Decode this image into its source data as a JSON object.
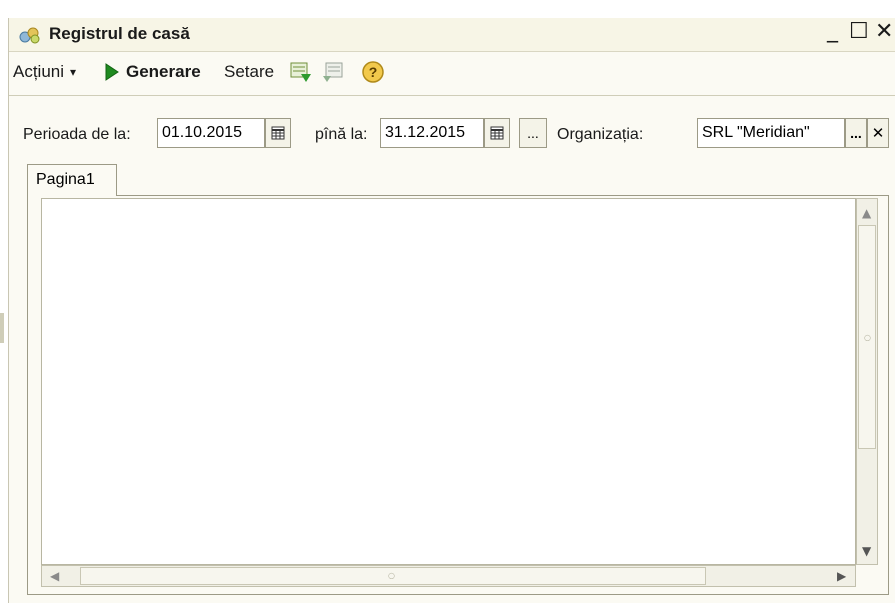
{
  "window": {
    "title": "Registrul de casă",
    "minimize": "_",
    "maximize": "☐",
    "close": "✕"
  },
  "toolbar": {
    "actions_label": "Acțiuni",
    "actions_arrow": "▾",
    "generate_label": "Generare",
    "settings_label": "Setare",
    "help_glyph": "?"
  },
  "filters": {
    "period_from_label": "Perioada de la:",
    "period_from_value": "01.10.2015",
    "period_to_label": "pînă la:",
    "period_to_value": "31.12.2015",
    "period_picker_label": "...",
    "organization_label": "Organizația:",
    "organization_value": "SRL \"Meridian\"",
    "organization_select_label": "...",
    "organization_clear_label": "✕"
  },
  "tabs": [
    {
      "label": "Pagina1",
      "active": true
    }
  ],
  "colors": {
    "window_bg": "#fbfaf3",
    "border": "#9c9a86",
    "generate_icon": "#1f8a1f"
  },
  "icons": {
    "title": "wallet-icon",
    "generate": "play-icon",
    "calendar": "calendar-icon",
    "export": "export-icon",
    "import": "import-icon",
    "help": "help-icon"
  }
}
